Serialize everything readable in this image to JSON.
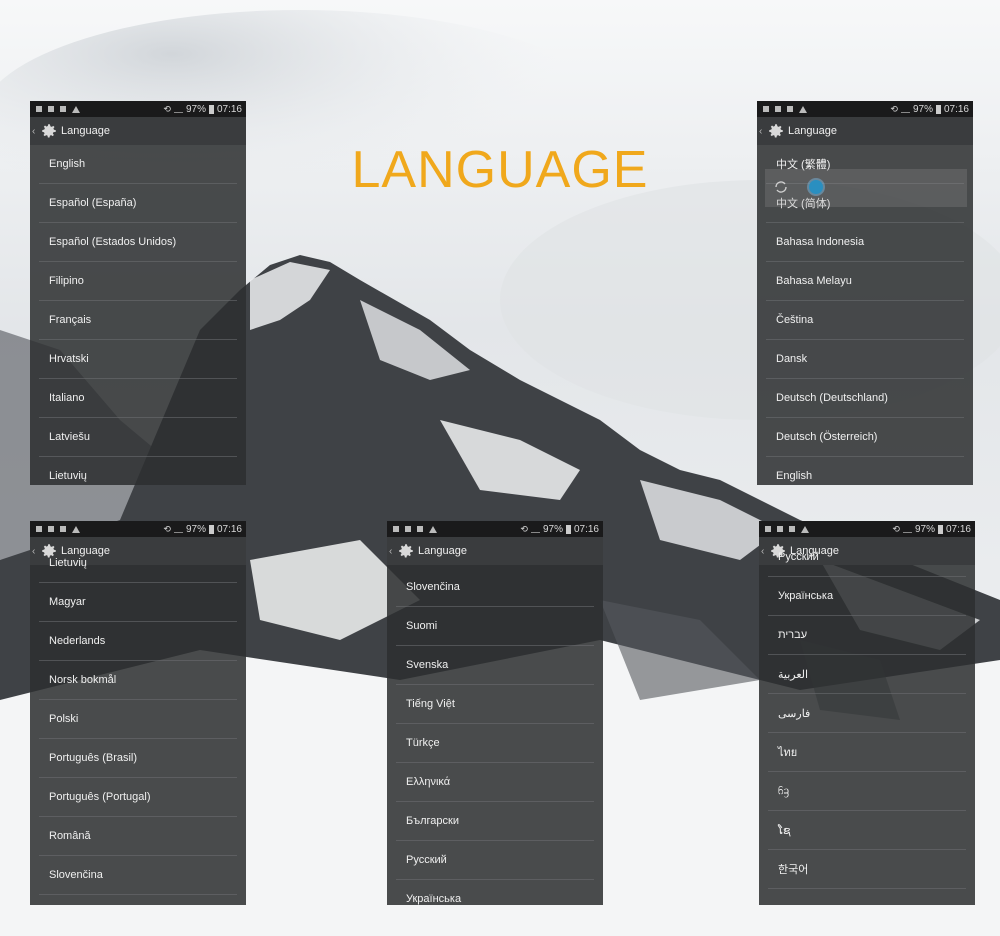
{
  "headline": "LANGUAGE",
  "colors": {
    "accent": "#f0a81c",
    "panel": "#2c2e30",
    "statusbar": "#1a1a1b"
  },
  "status": {
    "battery": "97%",
    "time": "07:16"
  },
  "screen_title": "Language",
  "icons": [
    "back-chevron-icon",
    "settings-gear-icon",
    "rotation-lock-icon",
    "signal-icon",
    "battery-icon"
  ],
  "panels": [
    {
      "items": [
        "English",
        "Español (España)",
        "Español (Estados Unidos)",
        "Filipino",
        "Français",
        "Hrvatski",
        "Italiano",
        "Latviešu",
        "Lietuvių"
      ]
    },
    {
      "items": [
        "中文 (繁體)",
        "中文 (简体)",
        "Bahasa Indonesia",
        "Bahasa Melayu",
        "Čeština",
        "Dansk",
        "Deutsch (Deutschland)",
        "Deutsch (Österreich)",
        "English"
      ]
    },
    {
      "items": [
        "Lietuvių",
        "Magyar",
        "Nederlands",
        "Norsk bokmål",
        "Polski",
        "Português (Brasil)",
        "Português (Portugal)",
        "Română",
        "Slovenčina"
      ]
    },
    {
      "items": [
        "Slovenčina",
        "Suomi",
        "Svenska",
        "Tiếng Việt",
        "Türkçe",
        "Ελληνικά",
        "Български",
        "Русский",
        "Українська"
      ]
    },
    {
      "items": [
        "Русский",
        "Українська",
        "עברית",
        "العربية",
        "فارسی",
        "ไทย",
        "ᦆᦃ",
        "ໂຊ",
        "한국어"
      ]
    }
  ]
}
